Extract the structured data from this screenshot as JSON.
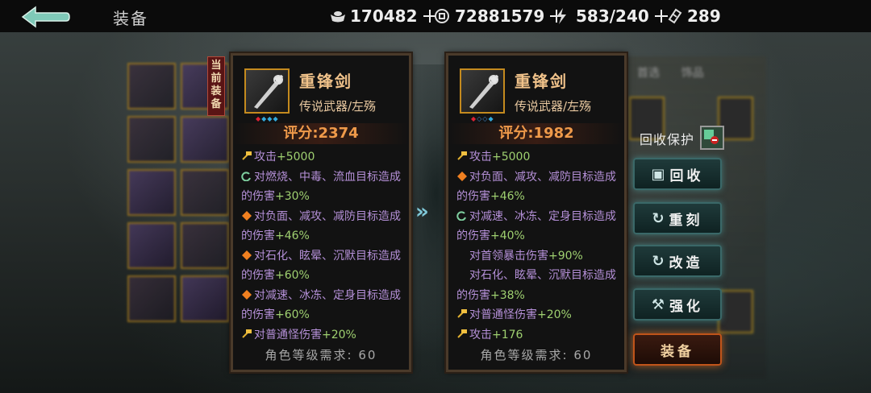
{
  "header": {
    "title": "装备",
    "resources": [
      {
        "icon": "silver-ingot-icon",
        "value": "170482"
      },
      {
        "icon": "coin-icon",
        "value": "72881579"
      },
      {
        "icon": "lightning-icon",
        "value": "583/240"
      },
      {
        "icon": "ticket-icon",
        "value": "289"
      }
    ]
  },
  "current_tag": "当前装备",
  "cards": [
    {
      "name": "重锋剑",
      "type": "传说武器/左殇",
      "score": "评分:2374",
      "attributes": [
        {
          "icon": "hammer-icon",
          "text": "攻击",
          "value": "+5000"
        },
        {
          "icon": "swirl-icon",
          "text": "对燃烧、中毒、流血目标造成的伤害",
          "value": "+30%"
        },
        {
          "icon": "diamond-icon",
          "text": "对负面、减攻、减防目标造成的伤害",
          "value": "+46%"
        },
        {
          "icon": "diamond-icon",
          "text": "对石化、眩晕、沉默目标造成的伤害",
          "value": "+60%"
        },
        {
          "icon": "diamond-icon",
          "text": "对减速、冰冻、定身目标造成的伤害",
          "value": "+60%"
        },
        {
          "icon": "hammer-icon",
          "text": "对普通怪伤害",
          "value": "+20%"
        }
      ],
      "requirement": "角色等级需求: 60"
    },
    {
      "name": "重锋剑",
      "type": "传说武器/左殇",
      "score": "评分:1982",
      "attributes": [
        {
          "icon": "hammer-icon",
          "text": "攻击",
          "value": "+5000"
        },
        {
          "icon": "diamond-icon",
          "text": "对负面、减攻、减防目标造成的伤害",
          "value": "+46%"
        },
        {
          "icon": "swirl-icon",
          "text": "对减速、冰冻、定身目标造成的伤害",
          "value": "+40%"
        },
        {
          "icon": "none",
          "text": "对首领暴击伤害",
          "value": "+90%"
        },
        {
          "icon": "none",
          "text": "对石化、眩晕、沉默目标造成的伤害",
          "value": "+38%"
        },
        {
          "icon": "hammer-icon",
          "text": "对普通怪伤害",
          "value": "+20%"
        },
        {
          "icon": "hammer-icon",
          "text": "攻击",
          "value": "+176"
        }
      ],
      "requirement": "角色等级需求: 60"
    }
  ],
  "right_panel": {
    "protect_label": "回收保护",
    "buttons": [
      {
        "icon": "recycle-box-icon",
        "label": "回收"
      },
      {
        "icon": "refresh-icon",
        "label": "重刻"
      },
      {
        "icon": "refresh-icon",
        "label": "改造"
      },
      {
        "icon": "hammer-icon",
        "label": "强化"
      },
      {
        "icon": "none",
        "label": "装备"
      }
    ],
    "tabs": [
      "首选",
      "饰品"
    ]
  },
  "colors": {
    "accent_orange": "#ef9a4a",
    "value_green": "#9fd070",
    "attr_purple": "#b590d8",
    "item_name": "#f0c28a"
  }
}
